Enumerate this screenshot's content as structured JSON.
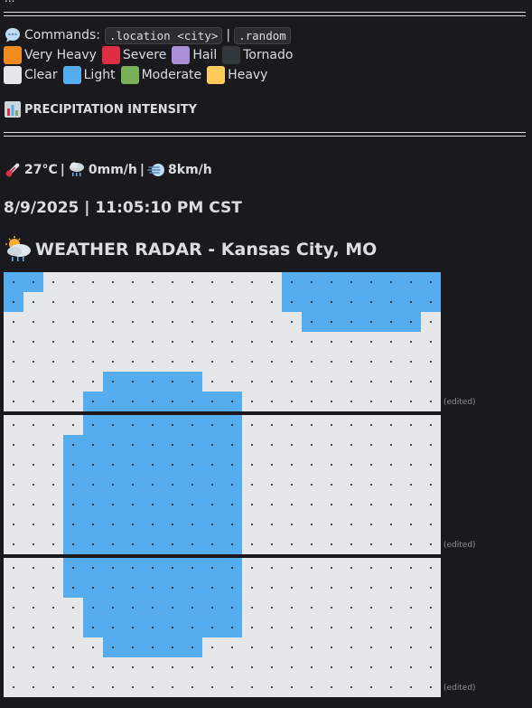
{
  "top_partial": "...",
  "commands": {
    "label": "Commands:",
    "cmd1": ".location <city>",
    "sep": "|",
    "cmd2": ".random"
  },
  "legend": [
    {
      "label": "Very Heavy",
      "color": "#f48b1f"
    },
    {
      "label": "Severe",
      "color": "#dd2e44"
    },
    {
      "label": "Hail",
      "color": "#aa8ed6"
    },
    {
      "label": "Tornado",
      "color": "#31373d"
    },
    {
      "label": "Clear",
      "color": "#e6e7e8"
    },
    {
      "label": "Light",
      "color": "#55acee"
    },
    {
      "label": "Moderate",
      "color": "#78b159"
    },
    {
      "label": "Heavy",
      "color": "#fdcb58"
    }
  ],
  "section_title": "PRECIPITATION INTENSITY",
  "stats": {
    "temp": "27°C",
    "precip": "0mm/h",
    "wind": "8km/h",
    "sep": "|"
  },
  "timestamp": "8/9/2025 | 11:05:10 PM CST",
  "radar_title": "WEATHER RADAR - Kansas City, MO",
  "edited_label": "(edited)",
  "colors": {
    "clear": "#e6e7e8",
    "light": "#55acee",
    "background": "#1a1a1e"
  },
  "radar_grids": [
    [
      "LL............LLLLLLLL",
      "L.............LLLLLLLL",
      "...............LLLLLL.",
      "......................",
      "......................",
      ".....LLLLL............",
      "....LLLLLLLL.........."
    ],
    [
      "....LLLLLLLL..........",
      "...LLLLLLLLL..........",
      "...LLLLLLLLL..........",
      "...LLLLLLLLL..........",
      "...LLLLLLLLL..........",
      "...LLLLLLLLL..........",
      "...LLLLLLLLL.........."
    ],
    [
      "...LLLLLLLLL..........",
      "...LLLLLLLLL..........",
      "....LLLLLLLL..........",
      "....LLLLLLLL..........",
      ".....LLLLL............",
      "......................",
      "......................"
    ]
  ]
}
